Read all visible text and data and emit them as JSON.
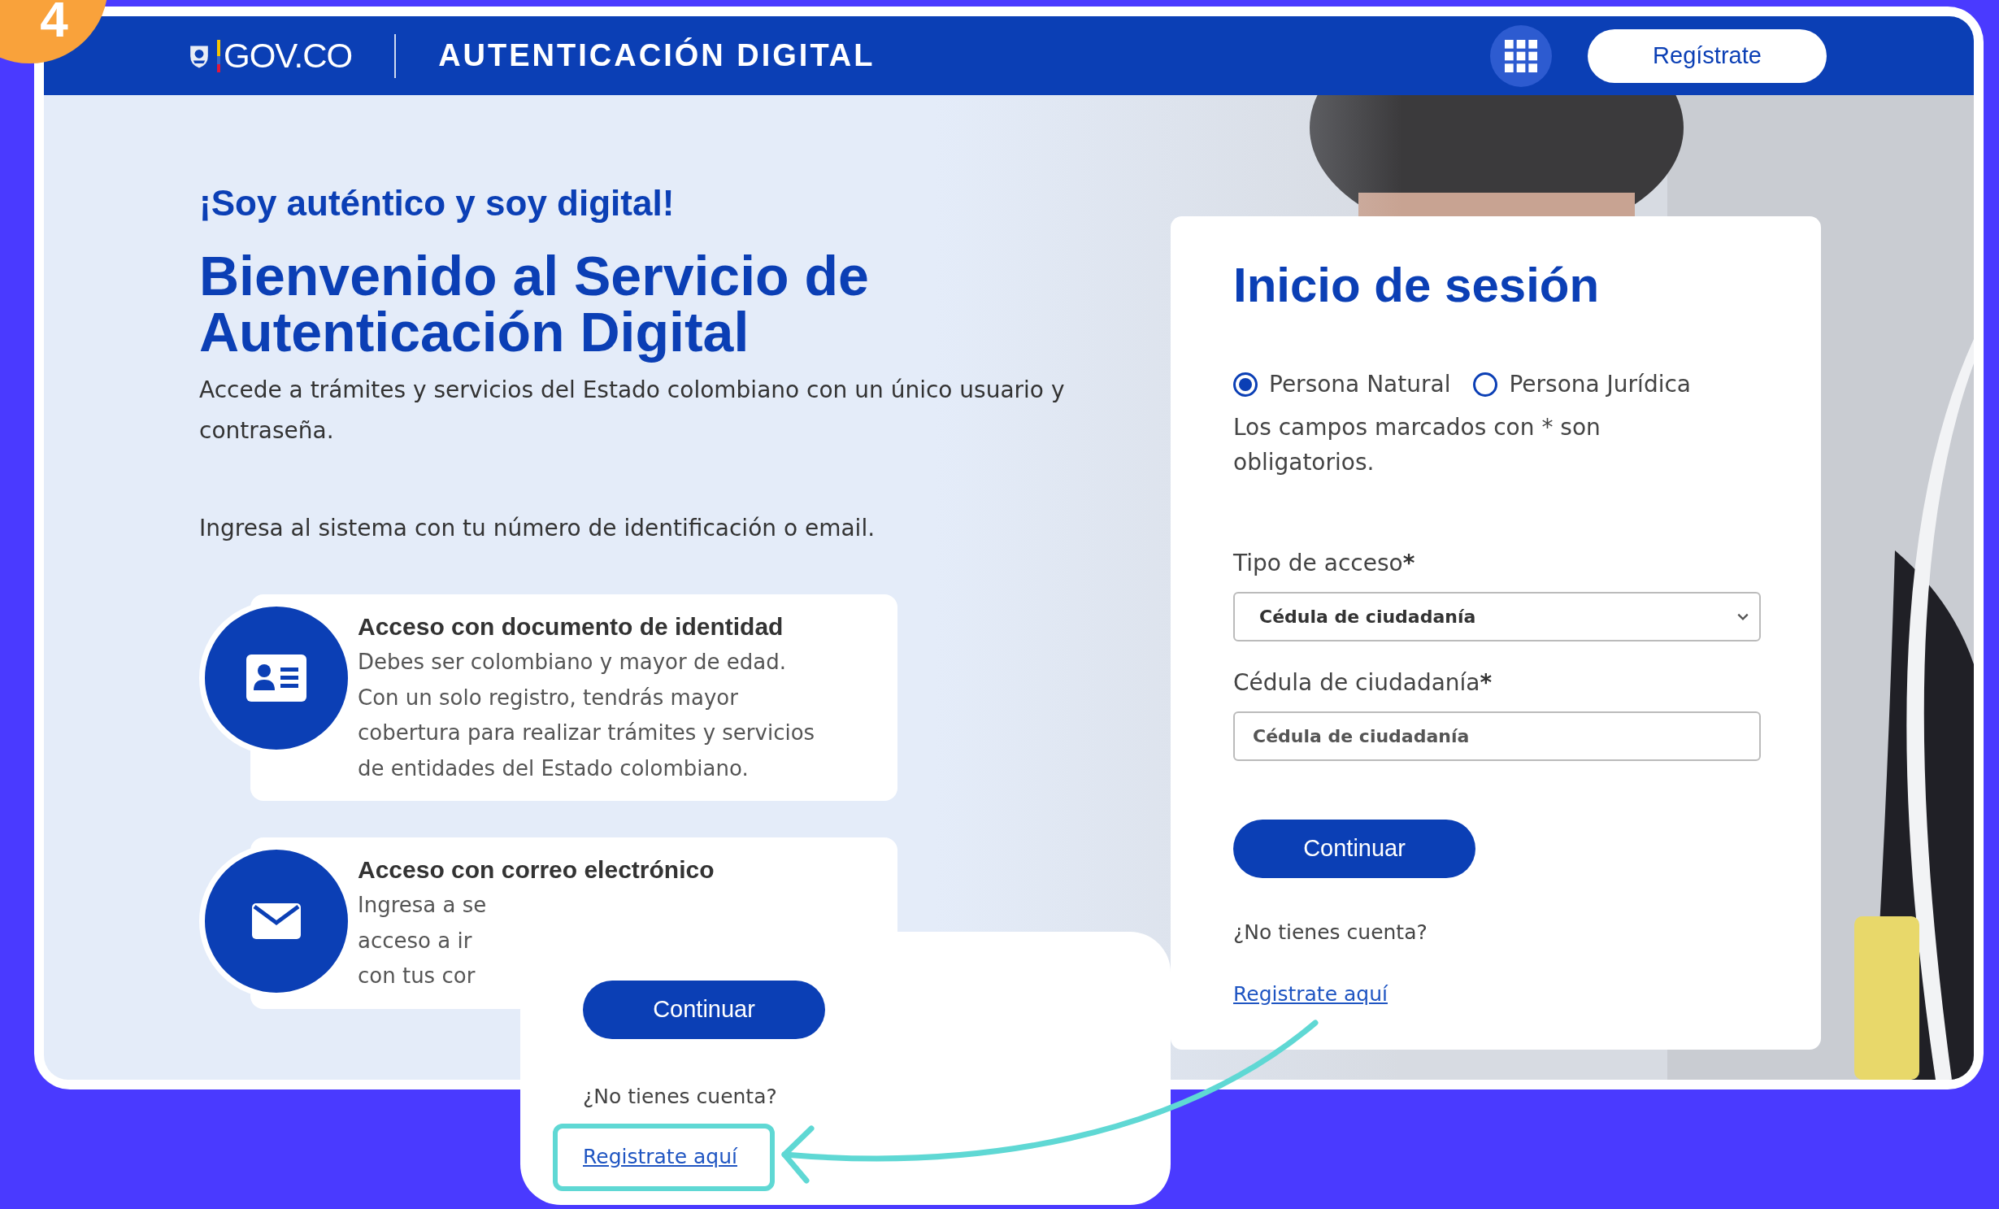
{
  "step_badge": "4",
  "header": {
    "logo": "GOV.CO",
    "title": "AUTENTICACIÓN DIGITAL",
    "register_button": "Regístrate"
  },
  "intro": {
    "tagline": "¡Soy auténtico y soy digital!",
    "heading": "Bienvenido al Servicio de Autenticación Digital",
    "description": "Accede a trámites y servicios del Estado colombiano con un único usuario y contraseña.",
    "instruction": "Ingresa al sistema con tu número de identificación o email."
  },
  "access_cards": [
    {
      "kind": "document",
      "title": "Acceso con documento de identidad",
      "body": "Debes ser colombiano y mayor de edad. Con un solo registro, tendrás mayor cobertura para realizar trámites y servicios de entidades del Estado colombiano."
    },
    {
      "kind": "email",
      "title": "Acceso con correo electrónico",
      "fragments": [
        "Ingresa a se",
        "acceso a ir",
        "con tus cor"
      ]
    }
  ],
  "login": {
    "title": "Inicio de sesión",
    "person_types": [
      {
        "label": "Persona Natural",
        "selected": true
      },
      {
        "label": "Persona Jurídica",
        "selected": false
      }
    ],
    "required_note": "Los campos marcados con * son obligatorios.",
    "access_type": {
      "label": "Tipo de acceso",
      "required_mark": "*",
      "value": "Cédula de ciudadanía"
    },
    "id_number": {
      "label": "Cédula de ciudadanía",
      "required_mark": "*",
      "placeholder": "Cédula de ciudadanía"
    },
    "continue_button": "Continuar",
    "no_account": "¿No tienes cuenta?",
    "register_link": "Registrate aquí"
  },
  "zoom_callout": {
    "continue_button": "Continuar",
    "no_account": "¿No tienes cuenta?",
    "register_link": "Registrate aquí",
    "highlighted": true
  }
}
